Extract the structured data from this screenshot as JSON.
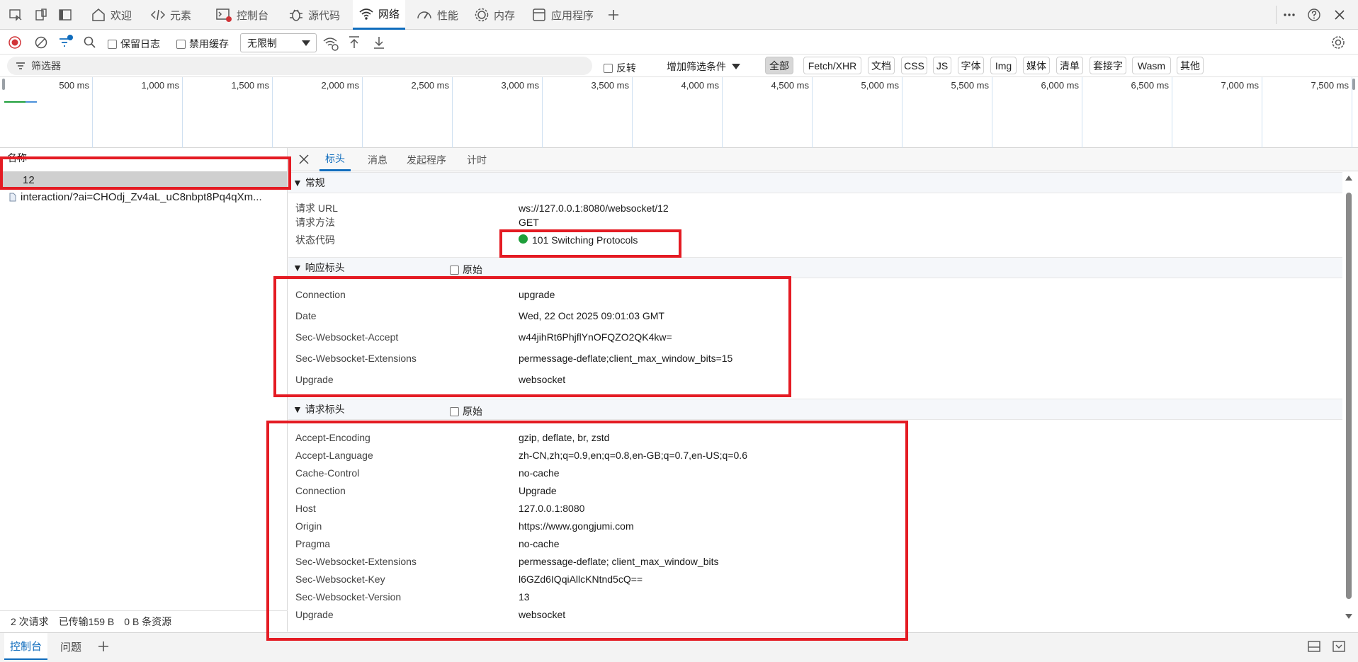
{
  "top_tabs": [
    {
      "label": "欢迎",
      "icon": "home-icon"
    },
    {
      "label": "元素",
      "icon": "code-icon"
    },
    {
      "label": "控制台",
      "icon": "console-icon"
    },
    {
      "label": "源代码",
      "icon": "bug-icon"
    },
    {
      "label": "网络",
      "icon": "wifi-icon",
      "active": true
    },
    {
      "label": "性能",
      "icon": "performance-icon"
    },
    {
      "label": "内存",
      "icon": "memory-icon"
    },
    {
      "label": "应用程序",
      "icon": "application-icon"
    }
  ],
  "toolbar": {
    "preserve_log": "保留日志",
    "disable_cache": "禁用缓存",
    "throttle": "无限制"
  },
  "filter": {
    "placeholder": "筛选器",
    "invert": "反转",
    "more_filters": "增加筛选条件",
    "types": [
      "全部",
      "Fetch/XHR",
      "文档",
      "CSS",
      "JS",
      "字体",
      "Img",
      "媒体",
      "清单",
      "套接字",
      "Wasm",
      "其他"
    ]
  },
  "timeline": {
    "ticks": [
      "500 ms",
      "1,000 ms",
      "1,500 ms",
      "2,000 ms",
      "2,500 ms",
      "3,000 ms",
      "3,500 ms",
      "4,000 ms",
      "4,500 ms",
      "5,000 ms",
      "5,500 ms",
      "6,000 ms",
      "6,500 ms",
      "7,000 ms",
      "7,500 ms"
    ]
  },
  "requests": {
    "column": "名称",
    "items": [
      "12",
      "interaction/?ai=CHOdj_Zv4aL_uC8nbpt8Pq4qXm..."
    ],
    "summary": [
      "2 次请求",
      "已传输159 B",
      "0 B 条资源"
    ]
  },
  "detail": {
    "tabs": [
      "标头",
      "消息",
      "发起程序",
      "计时"
    ],
    "general_title": "常规",
    "general": [
      {
        "k": "请求 URL",
        "v": "ws://127.0.0.1:8080/websocket/12"
      },
      {
        "k": "请求方法",
        "v": "GET"
      },
      {
        "k": "状态代码",
        "v": "101 Switching Protocols"
      }
    ],
    "response_title": "响应标头",
    "raw_label": "原始",
    "response_headers": [
      {
        "k": "Connection",
        "v": "upgrade"
      },
      {
        "k": "Date",
        "v": "Wed, 22 Oct 2025 09:01:03 GMT"
      },
      {
        "k": "Sec-Websocket-Accept",
        "v": "w44jihRt6PhjflYnOFQZO2QK4kw="
      },
      {
        "k": "Sec-Websocket-Extensions",
        "v": "permessage-deflate;client_max_window_bits=15"
      },
      {
        "k": "Upgrade",
        "v": "websocket"
      }
    ],
    "request_title": "请求标头",
    "request_headers": [
      {
        "k": "Accept-Encoding",
        "v": "gzip, deflate, br, zstd"
      },
      {
        "k": "Accept-Language",
        "v": "zh-CN,zh;q=0.9,en;q=0.8,en-GB;q=0.7,en-US;q=0.6"
      },
      {
        "k": "Cache-Control",
        "v": "no-cache"
      },
      {
        "k": "Connection",
        "v": "Upgrade"
      },
      {
        "k": "Host",
        "v": "127.0.0.1:8080"
      },
      {
        "k": "Origin",
        "v": "https://www.gongjumi.com"
      },
      {
        "k": "Pragma",
        "v": "no-cache"
      },
      {
        "k": "Sec-Websocket-Extensions",
        "v": "permessage-deflate; client_max_window_bits"
      },
      {
        "k": "Sec-Websocket-Key",
        "v": "l6GZd6IQqiAllcKNtnd5cQ=="
      },
      {
        "k": "Sec-Websocket-Version",
        "v": "13"
      },
      {
        "k": "Upgrade",
        "v": "websocket"
      }
    ]
  },
  "drawer": {
    "tabs": [
      "控制台",
      "问题"
    ]
  },
  "colors": {
    "accent": "#0f6cbd",
    "highlight": "#e41b23",
    "status_ok": "#1e9e3a"
  }
}
